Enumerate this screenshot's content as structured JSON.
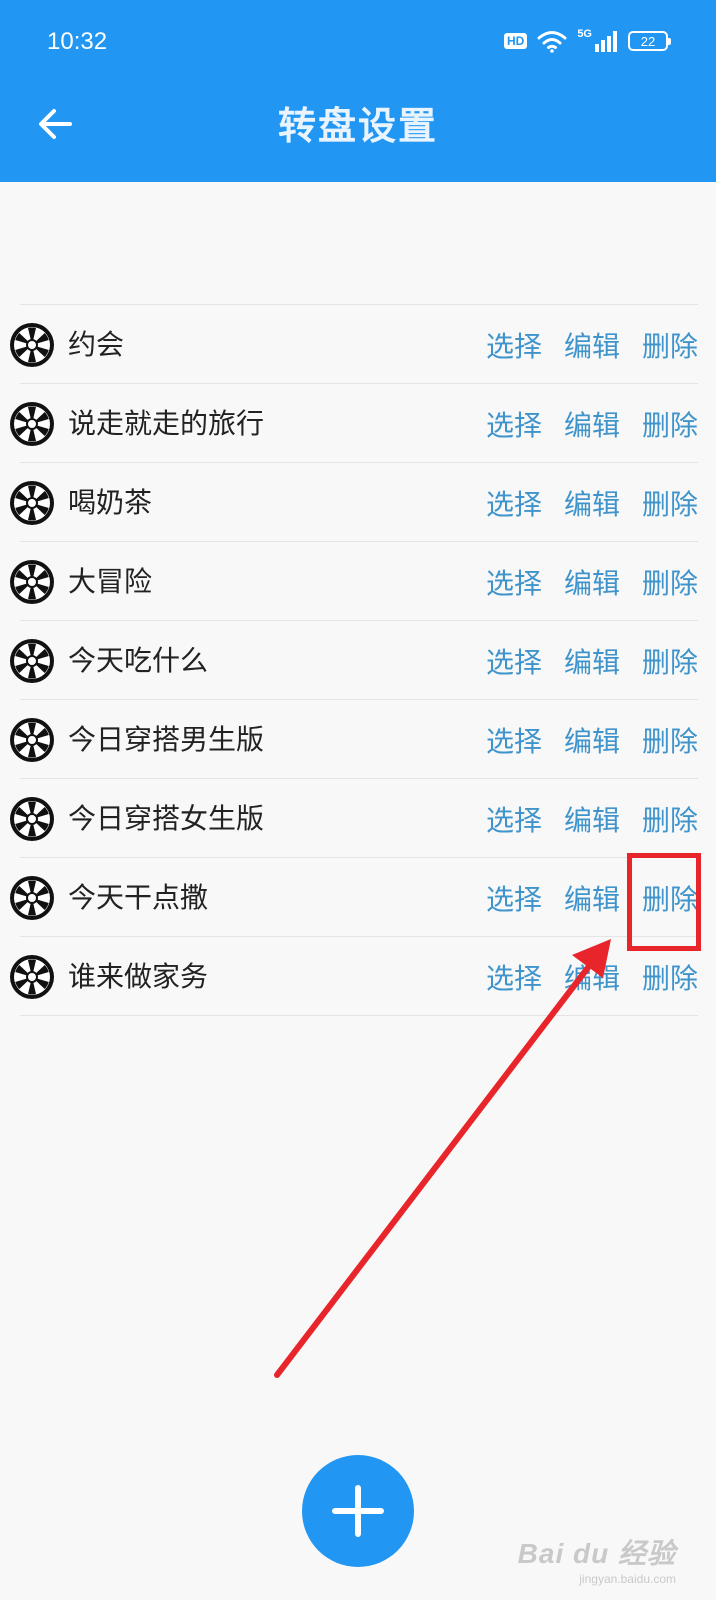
{
  "status_bar": {
    "time": "10:32",
    "hd_label": "HD",
    "network_label": "5G",
    "battery_level": "22"
  },
  "header": {
    "title": "转盘设置",
    "back_icon": "arrow-left-icon"
  },
  "actions": {
    "select_label": "选择",
    "edit_label": "编辑",
    "delete_label": "删除"
  },
  "wheels": [
    {
      "name": "约会"
    },
    {
      "name": "说走就走的旅行"
    },
    {
      "name": "喝奶茶"
    },
    {
      "name": "大冒险"
    },
    {
      "name": "今天吃什么"
    },
    {
      "name": "今日穿搭男生版"
    },
    {
      "name": "今日穿搭女生版"
    },
    {
      "name": "今天干点撒"
    },
    {
      "name": "谁来做家务"
    }
  ],
  "fab": {
    "icon": "plus-icon"
  },
  "watermark": {
    "brand": "Bai du 经验",
    "url": "jingyan.baidu.com"
  },
  "colors": {
    "primary": "#2196f3",
    "action_text": "#3f94cc",
    "annotation": "#e8252b",
    "background": "#f8f8f8"
  }
}
